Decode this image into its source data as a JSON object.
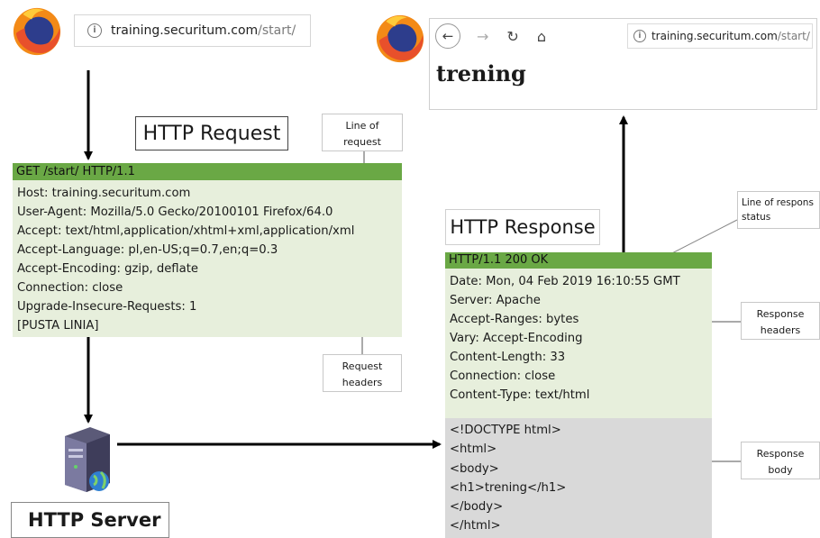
{
  "browser_left": {
    "url": "training.securitum.com/start/",
    "url_host": "training.securitum.com",
    "url_path": "/start/"
  },
  "browser_right": {
    "url_host": "training.securitum.com",
    "url_path": "/start/",
    "page_heading": "trening"
  },
  "labels": {
    "http_request": "HTTP Request",
    "http_response": "HTTP Response",
    "http_server": "HTTP Server"
  },
  "notes": {
    "line_of_request": [
      "Line of",
      "request"
    ],
    "request_headers": [
      "Request",
      "headers"
    ],
    "line_of_response_status": [
      "Line of respons",
      "status"
    ],
    "response_headers": [
      "Response",
      "headers"
    ],
    "response_body": [
      "Response",
      "body"
    ]
  },
  "request": {
    "request_line": "GET /start/ HTTP/1.1",
    "headers": [
      "Host: training.securitum.com",
      "User-Agent: Mozilla/5.0 Gecko/20100101 Firefox/64.0",
      "Accept: text/html,application/xhtml+xml,application/xml",
      "Accept-Language: pl,en-US;q=0.7,en;q=0.3",
      "Accept-Encoding: gzip, deflate",
      "Connection: close",
      "Upgrade-Insecure-Requests: 1",
      "[PUSTA LINIA]"
    ]
  },
  "response": {
    "status_line": "HTTP/1.1 200 OK",
    "headers": [
      "Date: Mon, 04 Feb 2019 16:10:55 GMT",
      "Server: Apache",
      "Accept-Ranges: bytes",
      "Vary: Accept-Encoding",
      "Content-Length: 33",
      "Connection: close",
      "Content-Type: text/html"
    ],
    "body": [
      "<!DOCTYPE html>",
      "<html>",
      "<body>",
      "<h1>trening</h1>",
      "</body>",
      "</html>"
    ]
  },
  "icons": [
    "firefox-logo-icon",
    "info-icon",
    "back-icon",
    "forward-icon",
    "reload-icon",
    "home-icon",
    "server-icon",
    "globe-icon"
  ]
}
